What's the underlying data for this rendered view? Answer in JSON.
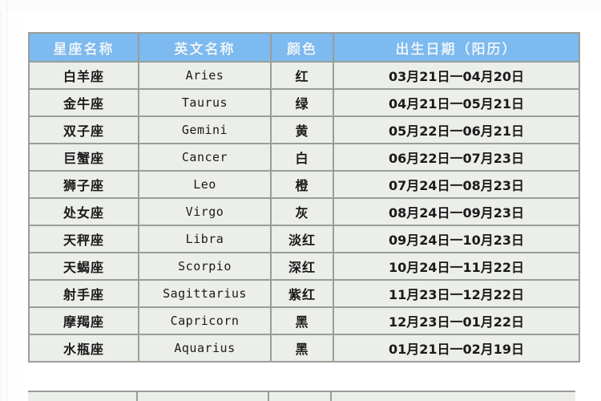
{
  "page": {
    "top_ghost_text": "· · · · ·     · ·      · ·",
    "background_color": "#ffffff"
  },
  "colors": {
    "header_bg": "#7cbaf0",
    "header_text": "#e8f4fd",
    "cell_bg": "#eceeea",
    "cell_text": "#1a1a1a",
    "grid_line": "#9a9e96"
  },
  "table": {
    "name": "zodiac-table",
    "headers": [
      "星座名称",
      "英文名称",
      "颜色",
      "出生日期（阳历）"
    ],
    "rows": [
      {
        "name": "白羊座",
        "english": "Aries",
        "color": "红",
        "dates": "03月21日一04月20日"
      },
      {
        "name": "金牛座",
        "english": "Taurus",
        "color": "绿",
        "dates": "04月21日一05月21日"
      },
      {
        "name": "双子座",
        "english": "Gemini",
        "color": "黄",
        "dates": "05月22日一06月21日"
      },
      {
        "name": "巨蟹座",
        "english": "Cancer",
        "color": "白",
        "dates": "06月22日一07月23日"
      },
      {
        "name": "狮子座",
        "english": "Leo",
        "color": "橙",
        "dates": "07月24日一08月23日"
      },
      {
        "name": "处女座",
        "english": "Virgo",
        "color": "灰",
        "dates": "08月24日一09月23日"
      },
      {
        "name": "天秤座",
        "english": "Libra",
        "color": "淡红",
        "dates": "09月24日一10月23日"
      },
      {
        "name": "天蝎座",
        "english": "Scorpio",
        "color": "深红",
        "dates": "10月24日一11月22日"
      },
      {
        "name": "射手座",
        "english": "Sagittarius",
        "color": "紫红",
        "dates": "11月23日一12月22日"
      },
      {
        "name": "摩羯座",
        "english": "Capricorn",
        "color": "黑",
        "dates": "12月23日一01月22日"
      },
      {
        "name": "水瓶座",
        "english": "Aquarius",
        "color": "黑",
        "dates": "01月21日一02月19日"
      }
    ]
  }
}
